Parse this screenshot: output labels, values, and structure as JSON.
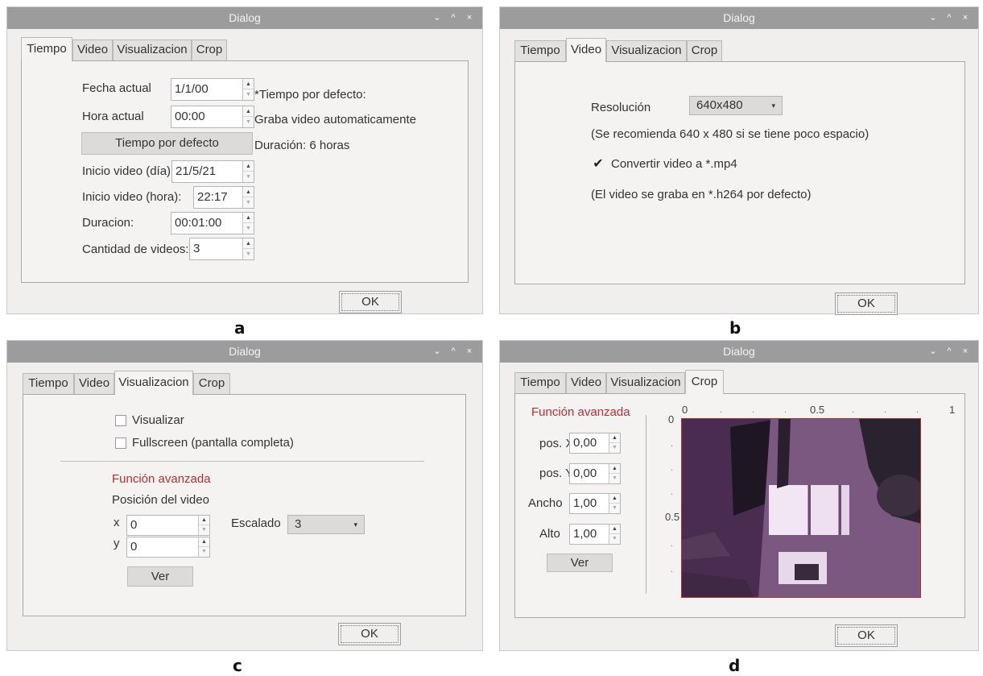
{
  "window": {
    "title": "Dialog",
    "controls": [
      "⌄",
      "^",
      "×"
    ]
  },
  "ok_label": "OK",
  "panel_labels": {
    "a": "a",
    "b": "b",
    "c": "c",
    "d": "d"
  },
  "tabs": [
    "Tiempo",
    "Video",
    "Visualizacion",
    "Crop"
  ],
  "panel_a": {
    "fecha_label": "Fecha actual",
    "fecha_value": "1/1/00",
    "hora_label": "Hora actual",
    "hora_value": "00:00",
    "default_button": "Tiempo por defecto",
    "info1": "*Tiempo por defecto:",
    "info2": "Graba video automaticamente",
    "info3": "Duración: 6 horas",
    "inicio_dia_label": "Inicio video (día):",
    "inicio_dia_value": "21/5/21",
    "inicio_hora_label": "Inicio video (hora):",
    "inicio_hora_value": "22:17",
    "duracion_label": "Duracion:",
    "duracion_value": "00:01:00",
    "cantidad_label": "Cantidad de videos:",
    "cantidad_value": "3"
  },
  "panel_b": {
    "resolucion_label": "Resolución",
    "resolucion_value": "640x480",
    "note1": "(Se recomienda 640 x 480 si se tiene poco espacio)",
    "convert_label": "Convertir video a *.mp4",
    "convert_checked": true,
    "note2": "(El video se graba en *.h264 por defecto)"
  },
  "panel_c": {
    "visualizar_label": "Visualizar",
    "fullscreen_label": "Fullscreen (pantalla completa)",
    "advanced_label": "Función avanzada",
    "position_label": "Posición del video",
    "x_label": "x",
    "x_value": "0",
    "y_label": "y",
    "y_value": "0",
    "escalado_label": "Escalado",
    "escalado_value": "3",
    "ver_label": "Ver"
  },
  "panel_d": {
    "advanced_label": "Función avanzada",
    "posx_label": "pos. X",
    "posx_value": "0,00",
    "posy_label": "pos. Y",
    "posy_value": "0,00",
    "ancho_label": "Ancho",
    "ancho_value": "1,00",
    "alto_label": "Alto",
    "alto_value": "1,00",
    "ver_label": "Ver",
    "top_ticks": [
      "0",
      "0.5",
      "1"
    ],
    "left_ticks": [
      "0",
      "0.5"
    ]
  },
  "colors": {
    "titlebar": "#9a9c9e",
    "accent_red": "#b33030",
    "background": "#f0efee"
  }
}
